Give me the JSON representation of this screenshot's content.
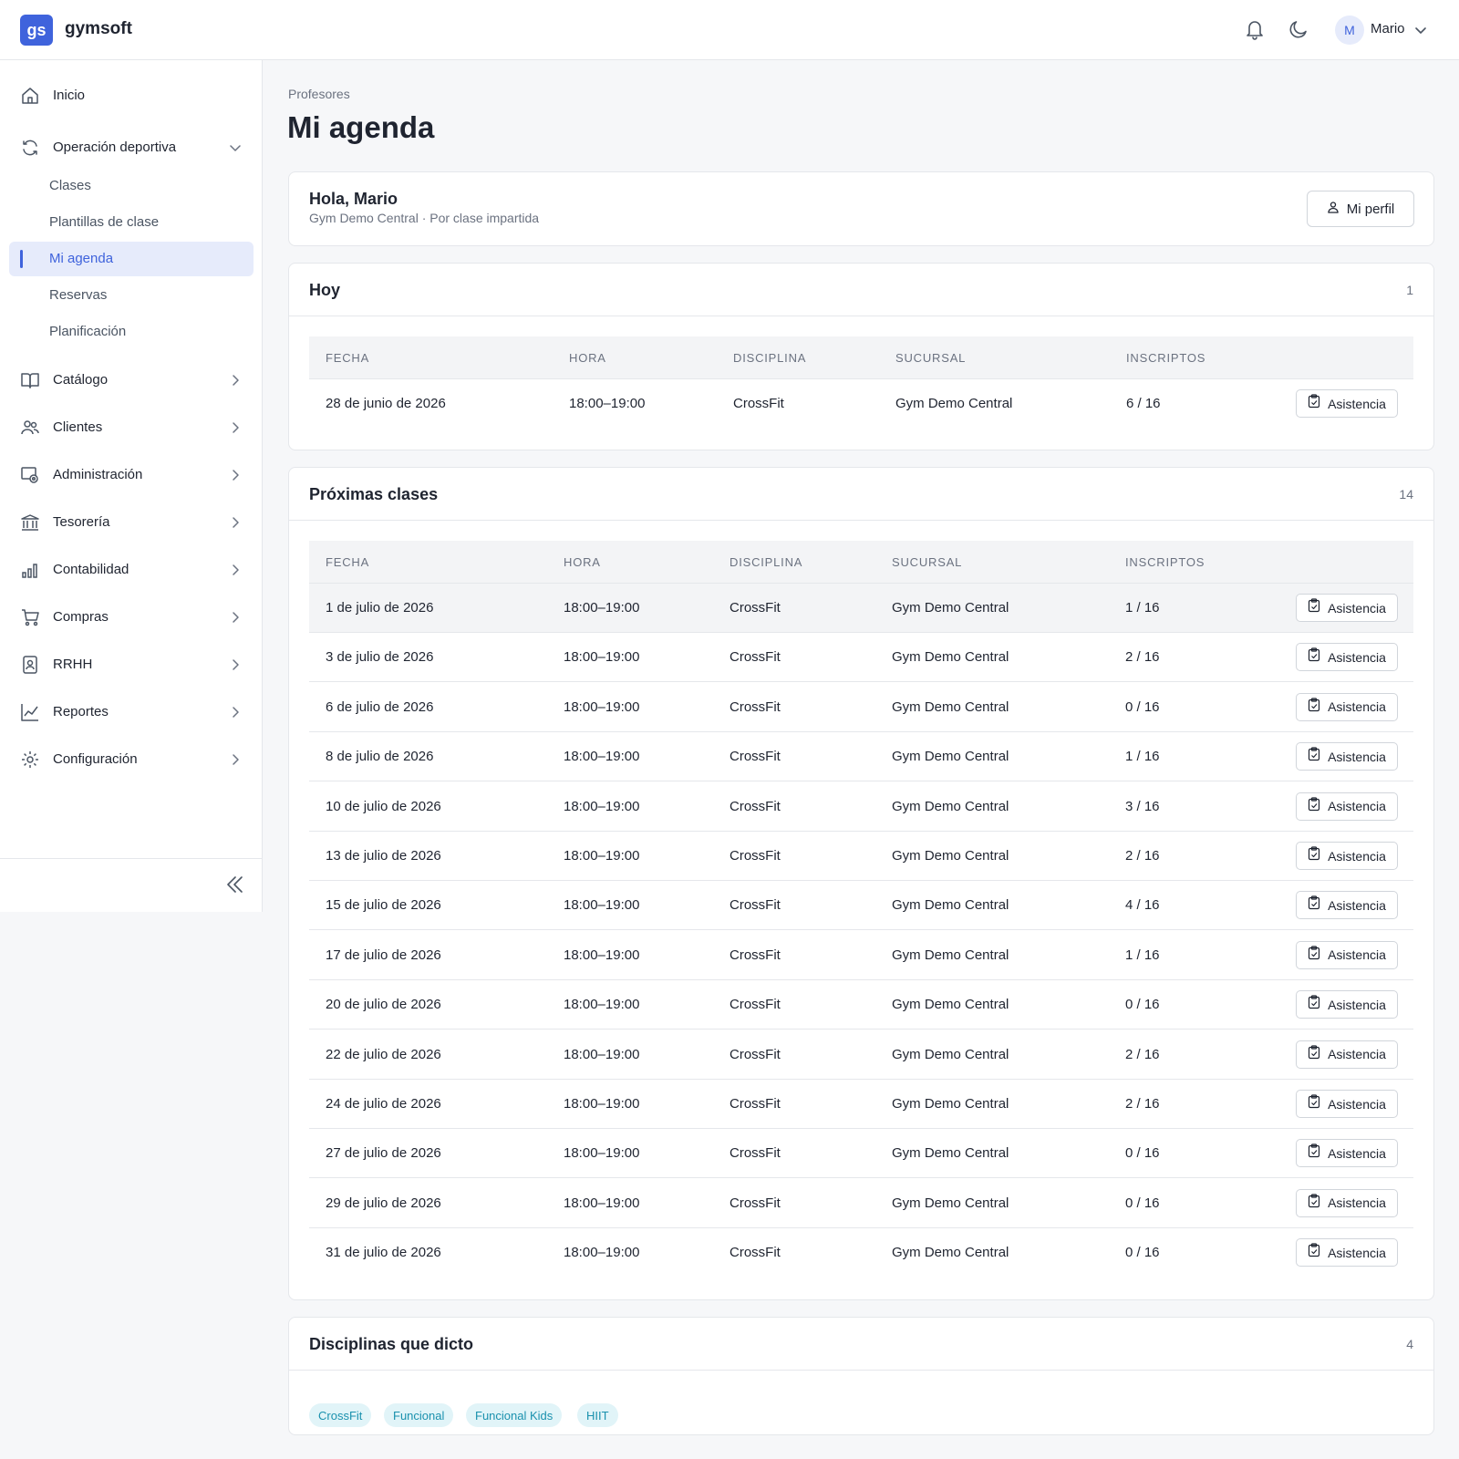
{
  "app": {
    "logo": "gs",
    "brand": "gymsoft"
  },
  "topbar": {
    "user_initial": "M",
    "user_name": "Mario",
    "icons": [
      "bell-icon",
      "moon-icon",
      "chevron-down-icon"
    ]
  },
  "sidebar": {
    "inicio": "Inicio",
    "operacion": "Operación deportiva",
    "sub_items": [
      "Clases",
      "Plantillas de clase",
      "Mi agenda",
      "Reservas",
      "Planificación"
    ],
    "sections": [
      "Catálogo",
      "Clientes",
      "Administración",
      "Tesorería",
      "Contabilidad",
      "Compras",
      "RRHH",
      "Reportes",
      "Configuración"
    ]
  },
  "page": {
    "breadcrumb": "Profesores",
    "title": "Mi agenda"
  },
  "greeting": {
    "title": "Hola, Mario",
    "subtitle": "Gym Demo Central · Por clase impartida",
    "profile_button": "Mi perfil"
  },
  "columns": [
    "FECHA",
    "HORA",
    "DISCIPLINA",
    "SUCURSAL",
    "INSCRIPTOS"
  ],
  "action_label": "Asistencia",
  "today": {
    "title": "Hoy",
    "count": "1",
    "rows": [
      [
        "28 de junio de 2026",
        "18:00–19:00",
        "CrossFit",
        "Gym Demo Central",
        "6 / 16"
      ]
    ]
  },
  "upcoming": {
    "title": "Próximas clases",
    "count": "14",
    "rows": [
      [
        "1 de julio de 2026",
        "18:00–19:00",
        "CrossFit",
        "Gym Demo Central",
        "1 / 16"
      ],
      [
        "3 de julio de 2026",
        "18:00–19:00",
        "CrossFit",
        "Gym Demo Central",
        "2 / 16"
      ],
      [
        "6 de julio de 2026",
        "18:00–19:00",
        "CrossFit",
        "Gym Demo Central",
        "0 / 16"
      ],
      [
        "8 de julio de 2026",
        "18:00–19:00",
        "CrossFit",
        "Gym Demo Central",
        "1 / 16"
      ],
      [
        "10 de julio de 2026",
        "18:00–19:00",
        "CrossFit",
        "Gym Demo Central",
        "3 / 16"
      ],
      [
        "13 de julio de 2026",
        "18:00–19:00",
        "CrossFit",
        "Gym Demo Central",
        "2 / 16"
      ],
      [
        "15 de julio de 2026",
        "18:00–19:00",
        "CrossFit",
        "Gym Demo Central",
        "4 / 16"
      ],
      [
        "17 de julio de 2026",
        "18:00–19:00",
        "CrossFit",
        "Gym Demo Central",
        "1 / 16"
      ],
      [
        "20 de julio de 2026",
        "18:00–19:00",
        "CrossFit",
        "Gym Demo Central",
        "0 / 16"
      ],
      [
        "22 de julio de 2026",
        "18:00–19:00",
        "CrossFit",
        "Gym Demo Central",
        "2 / 16"
      ],
      [
        "24 de julio de 2026",
        "18:00–19:00",
        "CrossFit",
        "Gym Demo Central",
        "2 / 16"
      ],
      [
        "27 de julio de 2026",
        "18:00–19:00",
        "CrossFit",
        "Gym Demo Central",
        "0 / 16"
      ],
      [
        "29 de julio de 2026",
        "18:00–19:00",
        "CrossFit",
        "Gym Demo Central",
        "0 / 16"
      ],
      [
        "31 de julio de 2026",
        "18:00–19:00",
        "CrossFit",
        "Gym Demo Central",
        "0 / 16"
      ]
    ]
  },
  "disciplines": {
    "title": "Disciplinas que dicto",
    "count": "4",
    "chips": [
      "CrossFit",
      "Funcional",
      "Funcional Kids",
      "HIIT"
    ]
  },
  "colors": {
    "accent": "#3f63dc",
    "chip_bg": "#e1f4f8",
    "chip_text": "#1a91ae"
  }
}
